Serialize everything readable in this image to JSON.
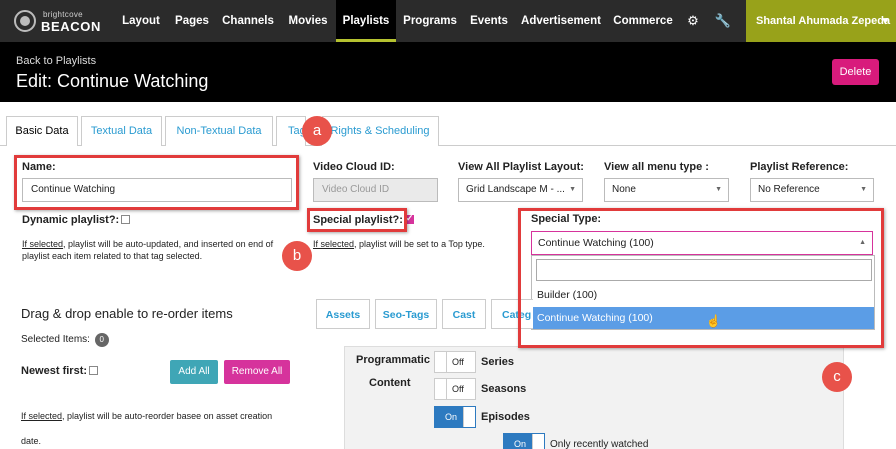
{
  "nav": {
    "logo_small": "brightcove",
    "logo_big": "BEACON",
    "items": [
      {
        "label": "Layout"
      },
      {
        "label": "Pages"
      },
      {
        "label": "Channels"
      },
      {
        "label": "Movies"
      },
      {
        "label": "Playlists"
      },
      {
        "label": "Programs"
      },
      {
        "label": "Events"
      },
      {
        "label": "Advertisement"
      },
      {
        "label": "Commerce"
      }
    ],
    "settings_icon": "gear-icon",
    "tools_icon": "wrench-icon",
    "user": "Shantal Ahumada Zepeda",
    "user_caret": "▾"
  },
  "header": {
    "back": "Back to Playlists",
    "title": "Edit: Continue Watching",
    "delete": "Delete"
  },
  "tabs": [
    "Basic Data",
    "Textual Data",
    "Non-Textual Data",
    "Tag",
    "Rights & Scheduling"
  ],
  "form": {
    "name_label": "Name:",
    "name_value": "Continue Watching",
    "video_cloud_label": "Video Cloud ID:",
    "video_cloud_placeholder": "Video Cloud ID",
    "layout_label": "View All Playlist Layout:",
    "layout_value": "Grid Landscape M - ...",
    "menu_type_label": "View all menu type :",
    "menu_type_value": "None",
    "reference_label": "Playlist Reference:",
    "reference_value": "No Reference",
    "dynamic_label": "Dynamic playlist?:",
    "dynamic_help_u": "If selected",
    "dynamic_help": ", playlist will be auto-updated, and inserted on end of",
    "dynamic_help2": "playlist each item related to that tag selected.",
    "special_label": "Special playlist?:",
    "special_help_u": "If selected",
    "special_help": ", playlist will be set to a Top type.",
    "special_type_label": "Special Type:",
    "special_type_value": "Continue Watching (100)",
    "special_type_options": [
      "Builder (100)",
      "Continue Watching (100)"
    ]
  },
  "order": {
    "title": "Drag & drop enable to re-order items",
    "selected_label": "Selected Items:",
    "selected_count": "0",
    "newest_label": "Newest first:",
    "add_all": "Add All",
    "remove_all": "Remove All",
    "help_u": "If selected",
    "help": ", playlist will be auto-reorder basee on asset creation",
    "help2": "date."
  },
  "subtabs": [
    "Assets",
    "Seo-Tags",
    "Cast",
    "Categ"
  ],
  "programmatic": {
    "label1": "Programmatic",
    "label2": "Content",
    "rows": [
      {
        "state": "Off",
        "label": "Series"
      },
      {
        "state": "Off",
        "label": "Seasons"
      },
      {
        "state": "On",
        "label": "Episodes"
      },
      {
        "state": "On",
        "label": "Only recently watched"
      }
    ]
  },
  "callouts": [
    "a",
    "b",
    "c"
  ],
  "colors": {
    "accent": "#d6339c",
    "annotation": "#e13b3b",
    "user_bg": "#98a21a",
    "nav_active": "#b5c230"
  }
}
